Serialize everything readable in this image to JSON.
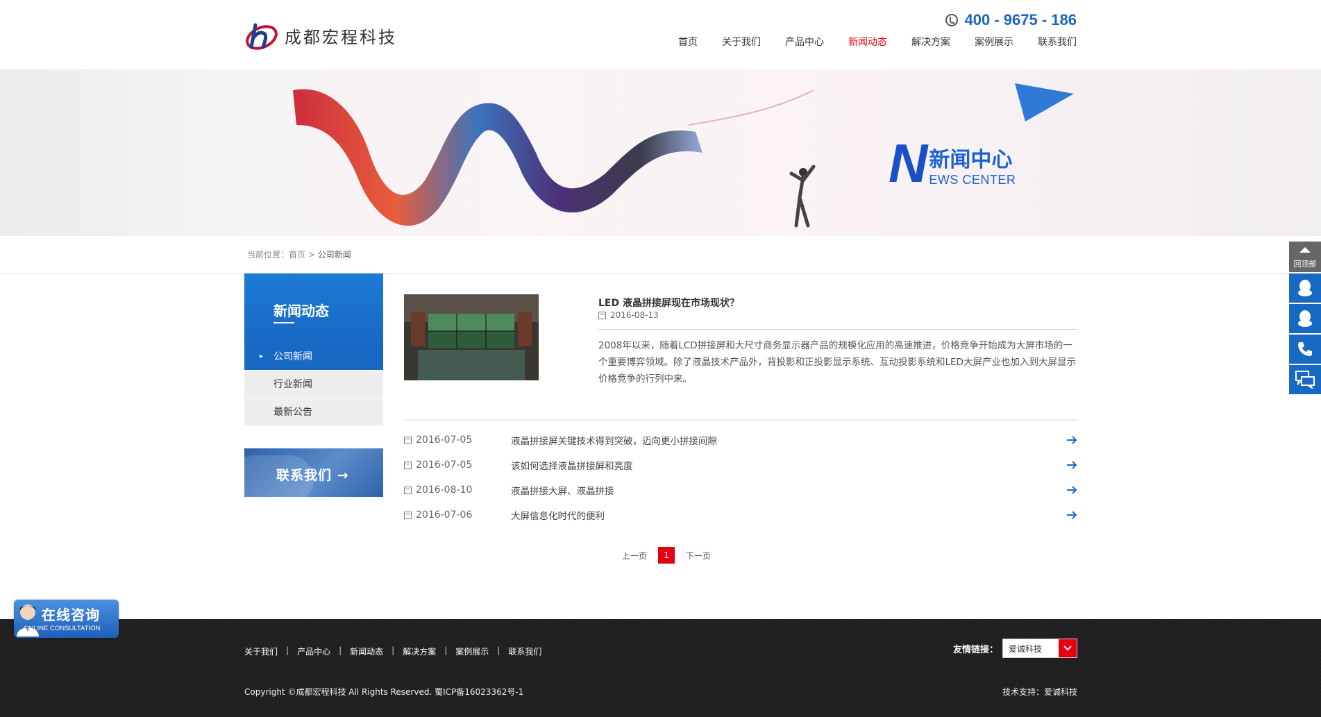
{
  "header": {
    "logo_text": "成都宏程科技",
    "phone": "400 - 9675 - 186",
    "nav": [
      "首页",
      "关于我们",
      "产品中心",
      "新闻动态",
      "解决方案",
      "案例展示",
      "联系我们"
    ],
    "active_nav": "新闻动态",
    "accent_color": "#e60012",
    "brand_color": "#1769c4"
  },
  "banner": {
    "cn_title": "新闻中心",
    "big_letter": "N",
    "en_title": "EWS CENTER"
  },
  "breadcrumb": {
    "prefix": "当前位置：",
    "home": "首页",
    "sep": ">",
    "current": "公司新闻"
  },
  "sidebar": {
    "title": "新闻动态",
    "items": [
      {
        "label": "公司新闻"
      },
      {
        "label": "行业新闻"
      },
      {
        "label": "最新公告"
      }
    ],
    "contact_label": "联系我们 →"
  },
  "featured": {
    "title": "LED 液晶拼接屏现在市场现状？",
    "date": "2016-08-13",
    "desc": "2008年以来，随着LCD拼接屏和大尺寸商务显示器产品的规模化应用的高速推进，价格竞争开始成为大屏市场的一个重要博弈领域。除了液晶技术产品外，背投影和正投影显示系统、互动投影系统和LED大屏产业也加入到大屏显示价格竞争的行列中来。"
  },
  "news": [
    {
      "date": "2016-07-05",
      "title": "液晶拼接屏关键技术得到突破，迈向更小拼接间隙"
    },
    {
      "date": "2016-07-05",
      "title": "该如何选择液晶拼接屏和亮度"
    },
    {
      "date": "2016-08-10",
      "title": "液晶拼接大屏、液晶拼接"
    },
    {
      "date": "2016-07-06",
      "title": "大屏信息化时代的便利"
    }
  ],
  "pager": {
    "prev": "上一页",
    "current": "1",
    "next": "下一页"
  },
  "footer": {
    "links": [
      "关于我们",
      "产品中心",
      "新闻动态",
      "解决方案",
      "案例展示",
      "联系我们"
    ],
    "link_sep": "|",
    "friend_label": "友情链接：",
    "friend_selected": "爱诚科技",
    "copyright": "Copyright ©成都宏程科技 All Rights Reserved. 蜀ICP备16023362号-1",
    "support": "技术支持：爱诚科技"
  },
  "float_bar": {
    "top_label": "回顶部"
  },
  "consult": {
    "cn": "在线咨询",
    "en": "ONLINE CONSULTATION"
  }
}
